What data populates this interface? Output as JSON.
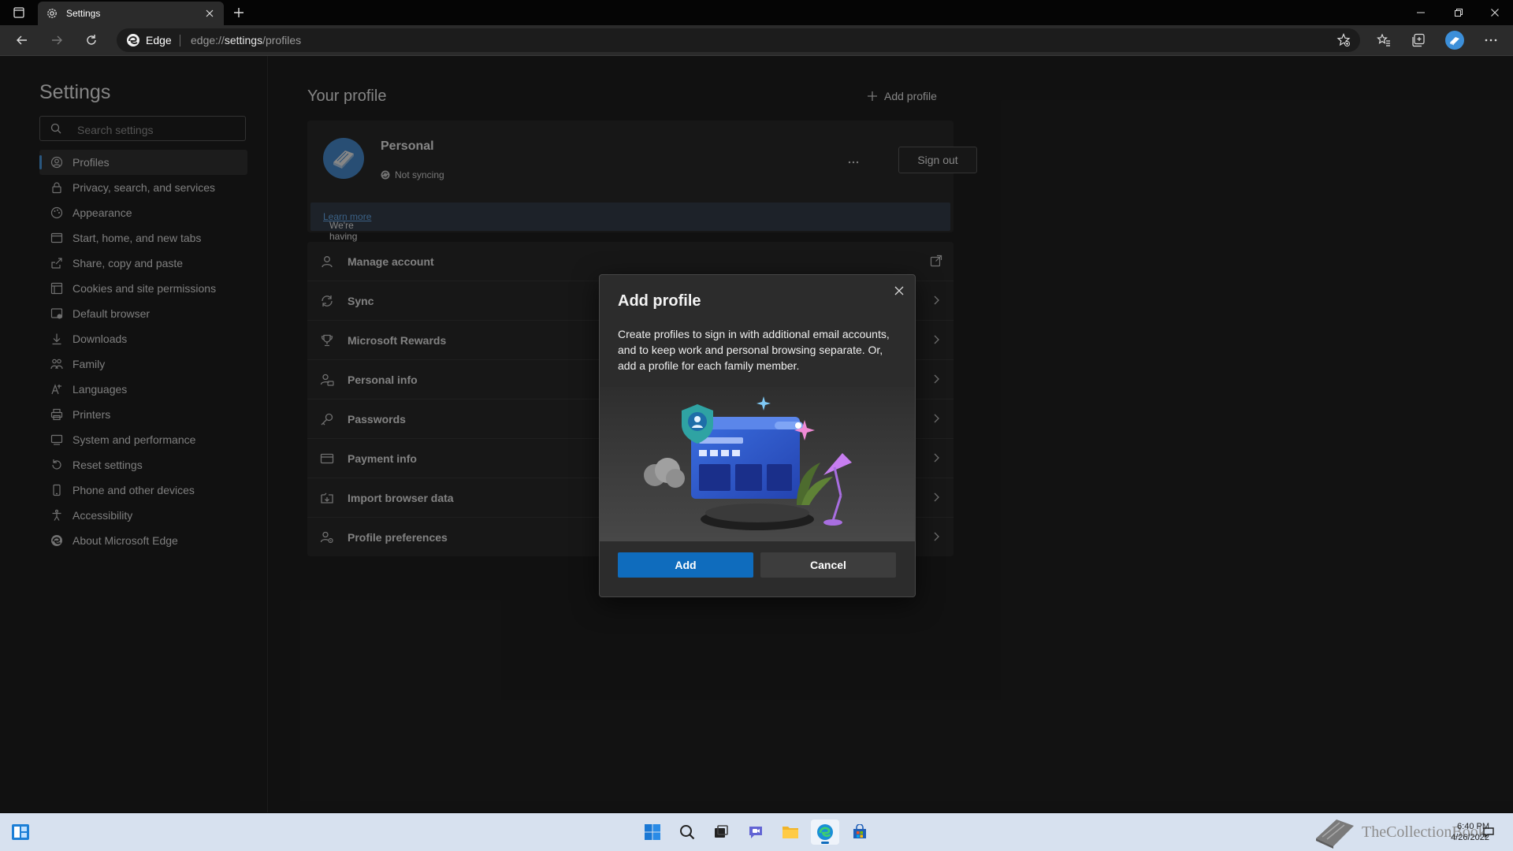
{
  "browser": {
    "tab_title": "Settings",
    "site_label": "Edge",
    "url_prefix": "edge://",
    "url_host": "settings",
    "url_path": "/profiles"
  },
  "sidebar": {
    "title": "Settings",
    "search_placeholder": "Search settings",
    "items": [
      {
        "label": "Profiles",
        "icon": "profile-icon",
        "active": true
      },
      {
        "label": "Privacy, search, and services",
        "icon": "lock-icon"
      },
      {
        "label": "Appearance",
        "icon": "appearance-icon"
      },
      {
        "label": "Start, home, and new tabs",
        "icon": "start-tabs-icon"
      },
      {
        "label": "Share, copy and paste",
        "icon": "share-icon"
      },
      {
        "label": "Cookies and site permissions",
        "icon": "cookies-icon"
      },
      {
        "label": "Default browser",
        "icon": "default-browser-icon"
      },
      {
        "label": "Downloads",
        "icon": "download-icon"
      },
      {
        "label": "Family",
        "icon": "family-icon"
      },
      {
        "label": "Languages",
        "icon": "languages-icon"
      },
      {
        "label": "Printers",
        "icon": "printer-icon"
      },
      {
        "label": "System and performance",
        "icon": "system-icon"
      },
      {
        "label": "Reset settings",
        "icon": "reset-icon"
      },
      {
        "label": "Phone and other devices",
        "icon": "phone-icon"
      },
      {
        "label": "Accessibility",
        "icon": "accessibility-icon"
      },
      {
        "label": "About Microsoft Edge",
        "icon": "edge-icon"
      }
    ]
  },
  "main": {
    "section_title": "Your profile",
    "add_profile_label": "Add profile",
    "profile": {
      "name": "Personal",
      "sync_status": "Not syncing",
      "sign_out_label": "Sign out",
      "banner_text": "We're having trouble syncing browsing data across your signed-in devices.",
      "banner_link": "Learn more"
    },
    "rows": [
      {
        "label": "Manage account",
        "icon": "person-icon",
        "end": "external-link-icon"
      },
      {
        "label": "Sync",
        "icon": "sync-icon",
        "end": "chevron-right-icon"
      },
      {
        "label": "Microsoft Rewards",
        "icon": "trophy-icon",
        "end": "chevron-right-icon"
      },
      {
        "label": "Personal info",
        "icon": "personal-info-icon",
        "end": "chevron-right-icon"
      },
      {
        "label": "Passwords",
        "icon": "key-icon",
        "end": "chevron-right-icon"
      },
      {
        "label": "Payment info",
        "icon": "card-icon",
        "end": "chevron-right-icon"
      },
      {
        "label": "Import browser data",
        "icon": "import-icon",
        "end": "chevron-right-icon"
      },
      {
        "label": "Profile preferences",
        "icon": "profile-prefs-icon",
        "end": "chevron-right-icon"
      }
    ]
  },
  "dialog": {
    "title": "Add profile",
    "description": "Create profiles to sign in with additional email accounts, and to keep work and personal browsing separate. Or, add a profile for each family member.",
    "add_label": "Add",
    "cancel_label": "Cancel"
  },
  "taskbar": {
    "apps": [
      "start-icon",
      "search-icon",
      "task-view-icon",
      "chat-icon",
      "file-explorer-icon",
      "edge-icon",
      "store-icon"
    ],
    "watermark": "TheCollectionBook",
    "time": "6:40 PM",
    "date": "4/26/2022"
  },
  "colors": {
    "accent": "#0f6cbd",
    "link": "#6ab0f3",
    "active_indicator": "#4c9ee8",
    "banner_bg": "#363f4b"
  }
}
